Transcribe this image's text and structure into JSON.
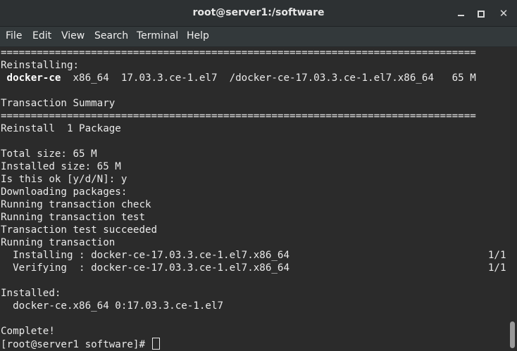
{
  "window": {
    "title": "root@server1:/software",
    "min_label": "minimize",
    "max_label": "maximize",
    "close_glyph": "✕"
  },
  "menu": {
    "items": [
      "File",
      "Edit",
      "View",
      "Search",
      "Terminal",
      "Help"
    ]
  },
  "terminal": {
    "separator": "===============================================================================",
    "reinstalling_header": "Reinstalling:",
    "package_name": " docker-ce",
    "package_rest": "  x86_64  17.03.3.ce-1.el7  /docker-ce-17.03.3.ce-1.el7.x86_64   65 M",
    "transaction_summary": "Transaction Summary",
    "reinstall_count": "Reinstall  1 Package",
    "total_size": "Total size: 65 M",
    "installed_size": "Installed size: 65 M",
    "confirm": "Is this ok [y/d/N]: y",
    "downloading": "Downloading packages:",
    "check": "Running transaction check",
    "test": "Running transaction test",
    "test_ok": "Transaction test succeeded",
    "running": "Running transaction",
    "installing": "  Installing : docker-ce-17.03.3.ce-1.el7.x86_64                                 1/1",
    "verifying": "  Verifying  : docker-ce-17.03.3.ce-1.el7.x86_64                                 1/1",
    "installed_header": "Installed:",
    "installed_pkg": "  docker-ce.x86_64 0:17.03.3.ce-1.el7",
    "complete": "Complete!",
    "prompt": "[root@server1 software]# "
  },
  "scrollbar": {
    "position_fraction": 0.98
  }
}
